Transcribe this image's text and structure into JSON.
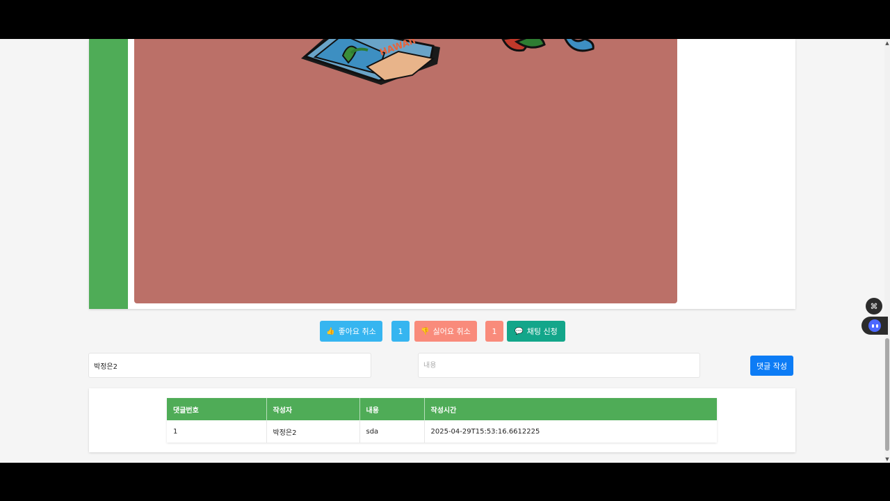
{
  "actions": {
    "like_label": "좋아요 취소",
    "like_count": "1",
    "dislike_label": "싫어요 취소",
    "dislike_count": "1",
    "chat_label": "채팅 신청"
  },
  "comment_form": {
    "author_value": "박정은2",
    "content_placeholder": "내용",
    "submit_label": "댓글 작성"
  },
  "comments": {
    "headers": [
      "댓글번호",
      "작성자",
      "내용",
      "작성시간"
    ],
    "rows": [
      [
        "1",
        "박정은2",
        "sda",
        "2025-04-29T15:53:16.6612225"
      ]
    ]
  },
  "post_image": {
    "banner_text": "HAWAII"
  },
  "colors": {
    "accent_green": "#4fac57",
    "like_blue": "#36b5f0",
    "dislike_salmon": "#f98b7b",
    "chat_teal": "#13a68a",
    "submit_blue": "#0d7cf5",
    "image_bg": "#bb7068"
  },
  "icons": {
    "like": "thumbs-up-icon",
    "dislike": "thumbs-down-icon",
    "chat": "speech-bubble-icon",
    "shortcut": "command-icon",
    "bot": "chatbot-icon"
  }
}
